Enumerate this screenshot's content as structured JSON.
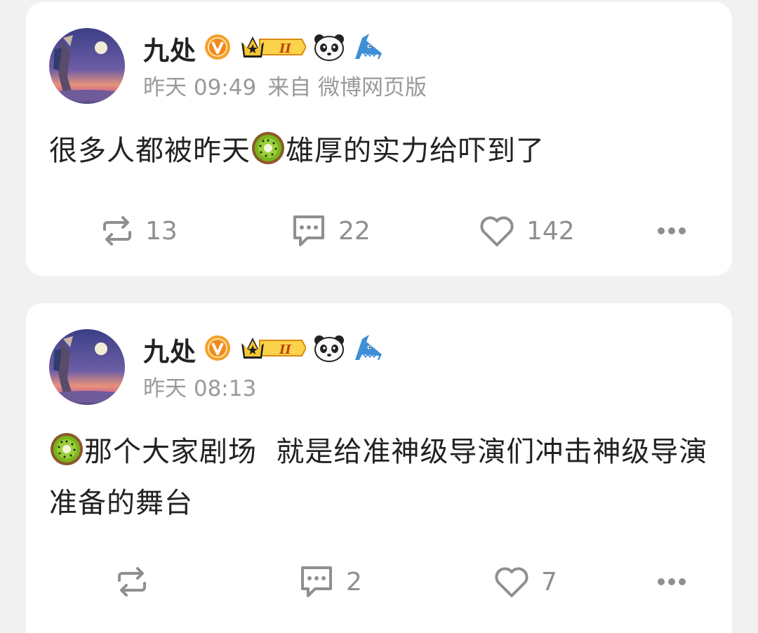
{
  "posts": [
    {
      "author": "九处",
      "time": "昨天 09:49",
      "source": "来自 微博网页版",
      "text_before": "很多人都被昨天",
      "text_after": "雄厚的实力给吓到了",
      "reposts": "13",
      "comments": "22",
      "likes": "142",
      "badge_level": "II"
    },
    {
      "author": "九处",
      "time": "昨天 08:13",
      "source": "",
      "text_before": "",
      "text_after": "那个大家剧场  就是给准神级导演们冲击神级导演准备的舞台",
      "reposts": "",
      "comments": "2",
      "likes": "7",
      "badge_level": "II"
    }
  ],
  "icons": {
    "verified": "verified-v-icon",
    "vip": "crown-level-icon",
    "panda": "panda-icon",
    "shark": "shark-icon",
    "kiwi": "kiwi-emoji",
    "repost": "repost-icon",
    "comment": "comment-icon",
    "like": "heart-icon",
    "more": "more-icon"
  },
  "colors": {
    "background": "#f1f1f1",
    "card": "#ffffff",
    "text": "#222222",
    "meta": "#9a9a9a",
    "action": "#8f8f8f",
    "verified": "#f08a1a",
    "crown": "#f5b81c"
  }
}
